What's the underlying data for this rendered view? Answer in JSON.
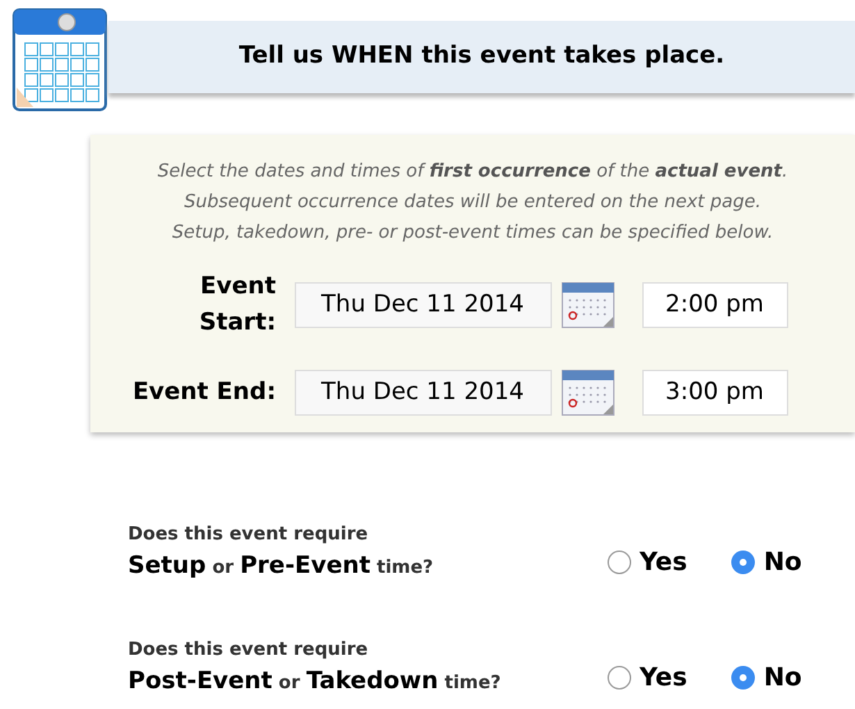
{
  "header": {
    "title": "Tell us WHEN this event takes place."
  },
  "instructions": [
    "Select the dates and times of **first occurrence** of the **actual event**.",
    "Subsequent occurrence dates will be entered on the next page.",
    "Setup, takedown, pre- or post-event times can be specified below."
  ],
  "fields": [
    {
      "label": "Event Start:",
      "date": "Thu Dec 11 2014",
      "time": "2:00 pm"
    },
    {
      "label": "Event End:",
      "date": "Thu Dec 11 2014",
      "time": "3:00 pm"
    }
  ],
  "questions": [
    {
      "line1": "Does this event require",
      "line2": "**Setup** or **Pre-Event** time?",
      "options": [
        {
          "label": "Yes",
          "selected": false
        },
        {
          "label": "No",
          "selected": true
        }
      ]
    },
    {
      "line1": "Does this event require",
      "line2": "**Post-Event** or **Takedown** time?",
      "options": [
        {
          "label": "Yes",
          "selected": false
        },
        {
          "label": "No",
          "selected": true
        }
      ]
    }
  ]
}
